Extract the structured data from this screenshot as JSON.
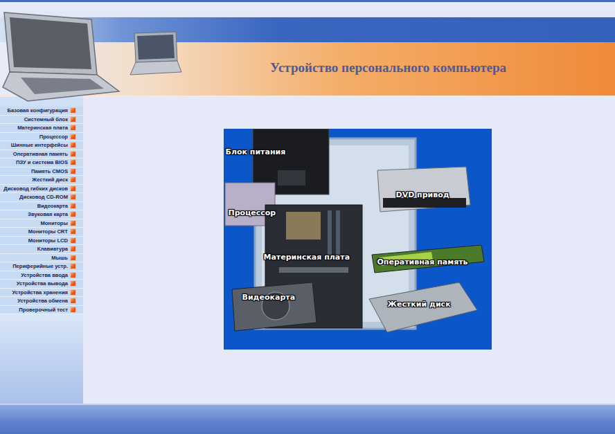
{
  "page": {
    "title": "Устройство персонального компьютера"
  },
  "sidebar": {
    "items": [
      {
        "label": "Базовая конфигурация"
      },
      {
        "label": "Системный блок"
      },
      {
        "label": "Материнская плата"
      },
      {
        "label": "Процессор"
      },
      {
        "label": "Шинные интерфейсы"
      },
      {
        "label": "Оперативная память"
      },
      {
        "label": "ПЗУ и система BIOS"
      },
      {
        "label": "Память CMOS"
      },
      {
        "label": "Жесткий диск"
      },
      {
        "label": "Дисковод гибких дисков"
      },
      {
        "label": "Дисковод CD-ROM"
      },
      {
        "label": "Видеокарта"
      },
      {
        "label": "Звуковая карта"
      },
      {
        "label": "Мониторы"
      },
      {
        "label": "Мониторы CRT"
      },
      {
        "label": "Мониторы LCD"
      },
      {
        "label": "Клавиатура"
      },
      {
        "label": "Мышь"
      },
      {
        "label": "Периферийные устр."
      },
      {
        "label": "Устройства ввода"
      },
      {
        "label": "Устройства вывода"
      },
      {
        "label": "Устройства хранения"
      },
      {
        "label": "Устройства обмена"
      },
      {
        "label": "Проверочный тест"
      }
    ]
  },
  "figure": {
    "labels": [
      "Блок питания",
      "DVD привод",
      "Процессор",
      "Материнская плата",
      "Оперативная память",
      "Видеокарта",
      "Жесткий диск"
    ]
  }
}
